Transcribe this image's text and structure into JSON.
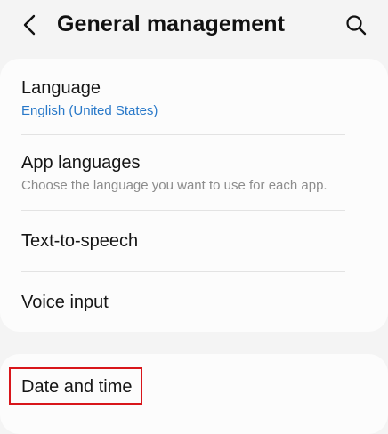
{
  "header": {
    "title": "General management",
    "back_icon": "chevron-left-icon",
    "search_icon": "search-icon"
  },
  "settings_list": [
    {
      "title": "Language",
      "subtitle": "English (United States)"
    },
    {
      "title": "App languages",
      "subtitle": "Choose the language you want to use for each app."
    },
    {
      "title": "Text-to-speech"
    },
    {
      "title": "Voice input"
    }
  ],
  "date_time": {
    "title": "Date and time"
  },
  "colors": {
    "accent": "#2979c9",
    "highlight": "#d8161b",
    "background": "#f4f4f4",
    "card": "#fcfcfc"
  }
}
